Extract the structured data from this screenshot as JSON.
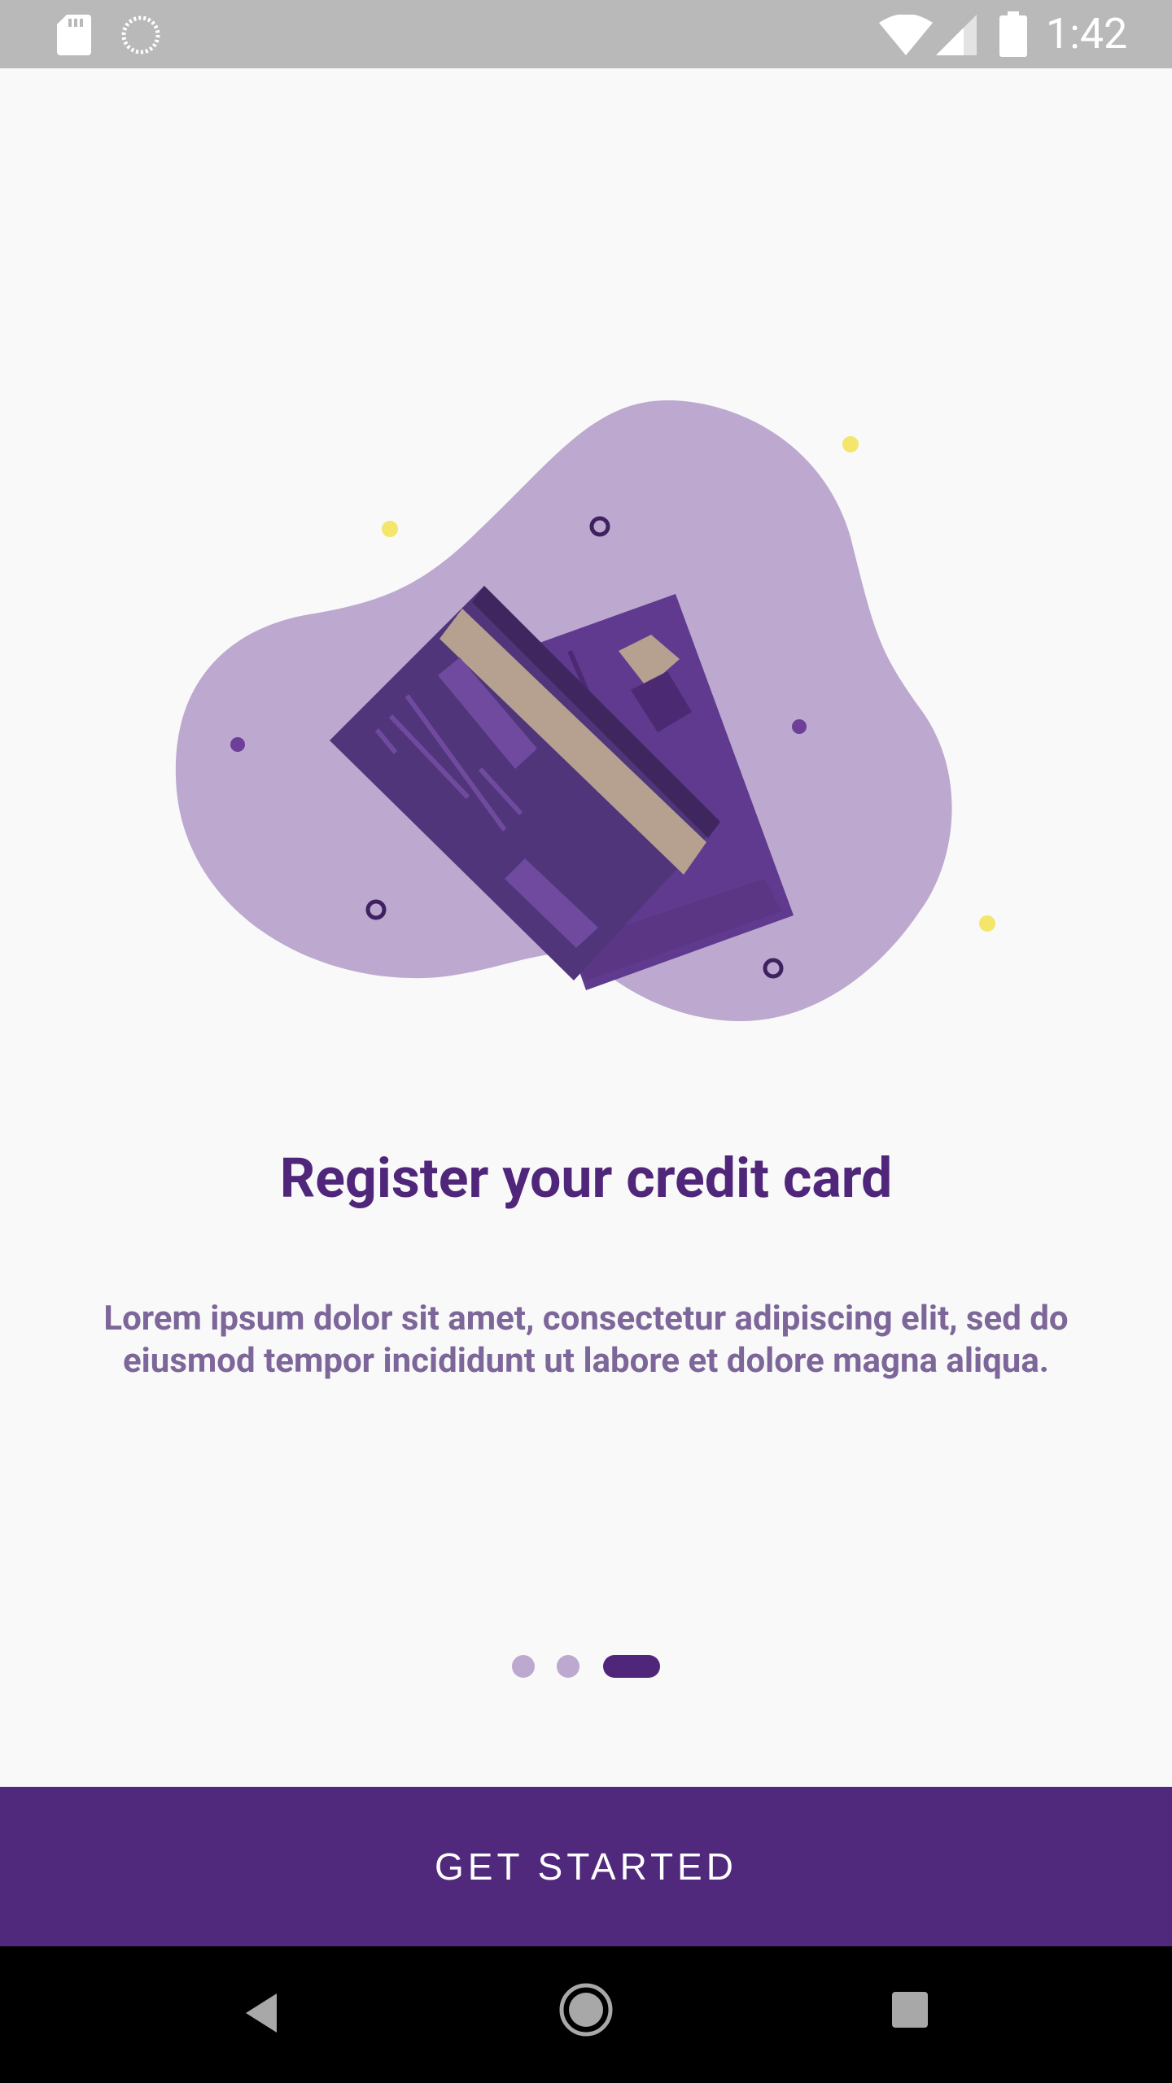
{
  "status_bar": {
    "time": "1:42",
    "icons": [
      "sd-card-icon",
      "sync-icon",
      "wifi-icon",
      "signal-icon",
      "battery-icon"
    ]
  },
  "illustration": {
    "subject": "credit-cards-icon",
    "colors": {
      "blob": "#bda8d0",
      "card_front": "#50357a",
      "card_back": "#5f3a8f",
      "stripe": "#b6a090",
      "accent_dot": "#f4e66a"
    }
  },
  "content": {
    "title": "Register your credit card",
    "description": "Lorem ipsum dolor sit amet, consectetur adipiscing elit, sed do eiusmod tempor incididunt ut labore et dolore magna aliqua."
  },
  "pager": {
    "page_count": 3,
    "current_page": 3
  },
  "cta": {
    "label": "GET STARTED",
    "color": "#50287c"
  },
  "nav_bar": {
    "icons": [
      "back-icon",
      "home-icon",
      "recents-icon"
    ]
  }
}
